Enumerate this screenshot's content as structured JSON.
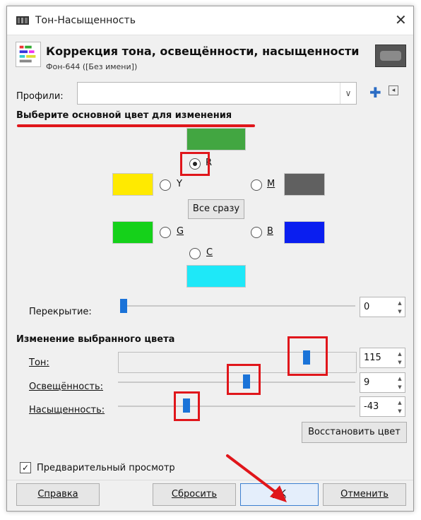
{
  "window": {
    "title": "Тон-Насыщенность",
    "close_glyph": "✕"
  },
  "header": {
    "title": "Коррекция тона, освещённости, насыщенности",
    "subtitle": "Фон-644 ([Без имени])"
  },
  "profiles": {
    "label": "Профили:",
    "value": "",
    "add_glyph": "✚",
    "menu_glyph": "◂",
    "dropdown_glyph": "∨"
  },
  "section_primary": {
    "title": "Выберите основной цвет для изменения",
    "swatches": {
      "red": "#42a641",
      "yellow": "#ffea00",
      "magenta": "#606060",
      "green": "#15d11a",
      "blue": "#0a1ef0",
      "cyan": "#1ee8f8"
    },
    "radios": {
      "r_label": "R",
      "y_label": "Y",
      "m_label": "M",
      "g_label": "G",
      "b_label": "B",
      "c_label": "C",
      "selected": "R"
    },
    "all_button": "Все сразу",
    "overlap_label": "Перекрытие:",
    "overlap_value": "0"
  },
  "section_adjust": {
    "title": "Изменение выбранного цвета",
    "hue_label": "Тон:",
    "hue_value": "115",
    "lightness_label": "Освещённость:",
    "lightness_value": "9",
    "saturation_label": "Насыщенность:",
    "saturation_value": "-43",
    "reset_color_button": "Восстановить цвет"
  },
  "preview": {
    "label": "Предварительный просмотр",
    "checked": true,
    "check_glyph": "✓"
  },
  "buttons": {
    "help": "Справка",
    "reset": "Сбросить",
    "ok": "OK",
    "cancel": "Отменить"
  },
  "spin_glyphs": {
    "up": "▲",
    "down": "▼"
  },
  "colors": {
    "accent": "#1b73d8",
    "annotation_red": "#e0161b"
  }
}
